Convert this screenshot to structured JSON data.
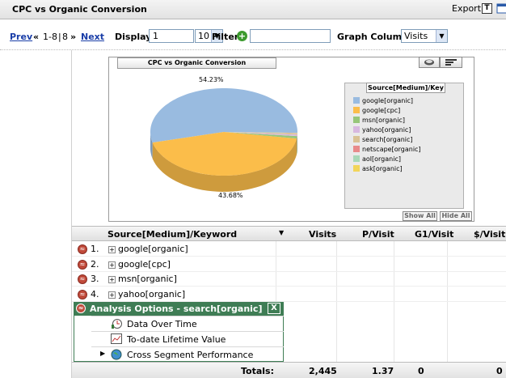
{
  "header": {
    "title": "CPC vs Organic Conversion",
    "export_label": "Export",
    "export_t": "T"
  },
  "toolbar": {
    "prev_label": "Prev",
    "pager_first": "«",
    "range": "1-8",
    "total": "8",
    "pager_last": "»",
    "next_label": "Next",
    "display_label": "Display",
    "display_start": "1",
    "display_count": "10",
    "filter_label": "Filter",
    "filter_value": "",
    "graph_column_label": "Graph Column",
    "graph_column_value": "Visits"
  },
  "chart": {
    "title": "CPC vs Organic Conversion",
    "legend_title": "Source[Medium]/Key",
    "show_all": "Show All",
    "hide_all": "Hide All",
    "label_top": "54.23%",
    "label_bottom": "43.68%"
  },
  "chart_data": {
    "type": "pie",
    "title": "CPC vs Organic Conversion",
    "categories": [
      "google[organic]",
      "google[cpc]",
      "msn[organic]",
      "yahoo[organic]",
      "search[organic]",
      "netscape[organic]",
      "aol[organic]",
      "ask[organic]"
    ],
    "values": [
      54.23,
      43.68,
      0.9,
      0.5,
      0.35,
      0.14,
      0.12,
      0.08
    ],
    "colors": [
      "#99bbe0",
      "#fbbd4a",
      "#97c67a",
      "#d8b8e0",
      "#d9c295",
      "#e88a8a",
      "#a8d8b8",
      "#f2d55a"
    ],
    "labeled_values": [
      "54.23%",
      "43.68%"
    ],
    "legend_position": "right"
  },
  "table": {
    "headers": {
      "keyword": "Source[Medium]/Keyword",
      "visits": "Visits",
      "pvisit": "P/Visit",
      "g1visit": "G1/Visit",
      "dvisits": "$/Visits"
    },
    "rows": [
      {
        "num": "1.",
        "label": "google[organic]"
      },
      {
        "num": "2.",
        "label": "google[cpc]"
      },
      {
        "num": "3.",
        "label": "msn[organic]"
      },
      {
        "num": "4.",
        "label": "yahoo[organic]"
      }
    ],
    "totals": {
      "label": "Totals:",
      "visits": "2,445",
      "pvisit": "1.37",
      "g1visit": "0",
      "dvisits": "0"
    }
  },
  "popup": {
    "title": "Analysis Options - search[organic]",
    "close": "X",
    "items": [
      {
        "label": "Data Over Time",
        "icon": "clock-chart-icon"
      },
      {
        "label": "To-date Lifetime Value",
        "icon": "line-chart-icon"
      },
      {
        "label": "Cross Segment Performance",
        "icon": "globe-icon"
      }
    ]
  }
}
